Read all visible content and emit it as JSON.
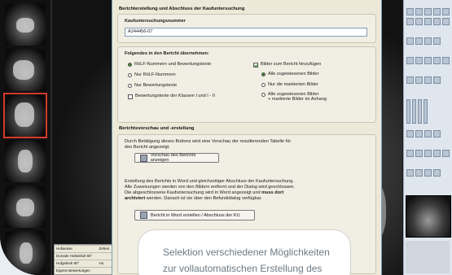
{
  "dialog": {
    "section1_title": "Berichterstellung und Abschluss der Kaufuntersuchung",
    "field_label": "Kaufuntersuchungsnummer",
    "field_value": "A244456-07",
    "section2_title": "Folgendes in den Bericht übernehmen:",
    "left_options": [
      {
        "label": "RöLF-Nummern und Bewertungstexte",
        "checked": true
      },
      {
        "label": "Nur RöLF-Nummern",
        "checked": false
      },
      {
        "label": "Nur Bewertungstexte",
        "checked": false
      }
    ],
    "checkbox_left": {
      "label": "Bewertungstexte der Klassen I und I - II",
      "checked": false
    },
    "checkbox_right": {
      "label": "Bilder zum Bericht hinzufügen",
      "checked": true
    },
    "right_options": [
      {
        "label": "Alle zugewiesenen Bilder",
        "checked": true
      },
      {
        "label": "Nur die markierten Bilder",
        "checked": false
      },
      {
        "label_line1": "Alle zugewiesenen Bilder",
        "label_line2": "+ markierte Bilder im Anhang",
        "checked": false
      }
    ],
    "section3_title": "Berichtsvorschau und -erstellung",
    "preview_text_line1": "Durch Betätigung dieses Buttons wird eine Vorschau der resultierenden Tabelle für",
    "preview_text_line2": "den Bericht angezeigt.",
    "preview_button": "Vorschau des Berichts anzeigen",
    "create_text_line1": "Erstellung des Berichts in Word und gleichzeitiger Abschluss der Kaufuntersuchung.",
    "create_text_line2": "Alle Zuweisungen werden von den Bildern entfernt und der Dialog wird geschlossen.",
    "create_text_line3a": "Die abgeschlossene Kaufuntersuchung wird in Word angezeigt und ",
    "create_text_line3b": "muss dort",
    "create_text_line4a": "archiviert",
    "create_text_line4b": " werden. Danach ist sie über den Befundidialog verfügbar.",
    "create_button": "Bericht in Word erstellen / Abschluss der KU"
  },
  "info_table": [
    [
      "Hufweiser",
      "Zehen"
    ],
    [
      "Dorsale Hufwinkel 80°",
      ""
    ],
    [
      "Hufgelenk 80°",
      "Hu"
    ],
    [
      "Eigene Bewertungen",
      ""
    ]
  ],
  "caption": {
    "line1": "Selektion verschiedener Möglichkeiten",
    "line2": "zur vollautomatischen Erstellung des"
  },
  "colors": {
    "dialog_bg": "#ece9d8",
    "radio_selected": "#2d7a1e",
    "caption_text": "#6b7a83",
    "active_thumb_border": "#d23a2a"
  }
}
